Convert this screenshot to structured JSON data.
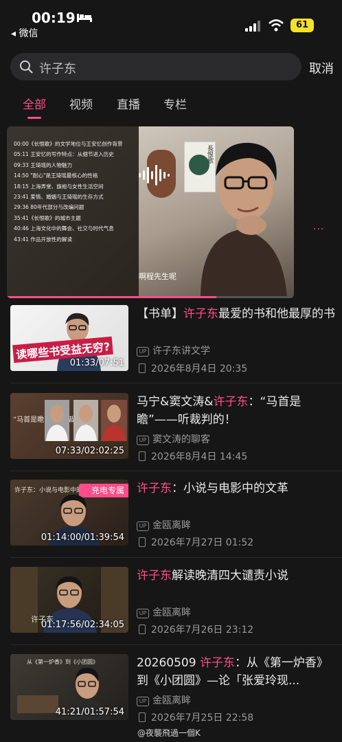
{
  "status_bar": {
    "time": "00:19",
    "back_app": "◂ 微信",
    "battery": "61"
  },
  "search": {
    "query": "许子东",
    "cancel": "取消"
  },
  "tabs": [
    {
      "label": "全部",
      "active": true
    },
    {
      "label": "视频",
      "active": false
    },
    {
      "label": "直播",
      "active": false
    },
    {
      "label": "专栏",
      "active": false
    }
  ],
  "player": {
    "chapters": [
      "00:00《长恨歌》的文学地位与王安忆创作背景",
      "05:11 王安忆的写作特点：从细节进入历史",
      "09:33 王琦瑶的人物魅力",
      "14:50 \"耐心\"是王琦瑶最核心的性格",
      "18:15 上海弄堂、旗袍与女性生活空间",
      "23:41 爱情、婚姻与王琦瑶的生存方式",
      "29:36 80年代部分与改编问题",
      "35:41《长恨歌》的城市主题",
      "40:46 上海文化中的舞会、社交与时代气息",
      "43:41 作品开放性的解读"
    ],
    "book_title": "長恨歌",
    "caption": "啊程先生呢",
    "progress": 0.73,
    "more": "···"
  },
  "results": [
    {
      "title_pre": "【书单】",
      "title_hl": "许子东",
      "title_post": "最爱的书和他最厚的书",
      "thumb_text": "读哪些书受益无穷?",
      "duration": "01:33/07:51",
      "uploader": "许子东讲文学",
      "date": "2026年8月4日 20:35"
    },
    {
      "title_pre": "马宁&窦文涛&",
      "title_hl": "许子东",
      "title_post": "：“马首是瞻”——听裁判的！",
      "thumb_text": "“马首是瞻”——听裁判的",
      "duration": "07:33/02:02:25",
      "uploader": "窦文涛的聊客",
      "date": "2026年8月4日 14:45"
    },
    {
      "title_pre": "",
      "title_hl": "许子东",
      "title_post": "：小说与电影中的文革",
      "thumb_text": "许子东：小说与电影中的文",
      "badge": "充电专属",
      "duration": "01:14:00/01:39:54",
      "uploader": "金瓯离眸",
      "date": "2026年7月27日 01:52"
    },
    {
      "title_pre": "",
      "title_hl": "许子东",
      "title_post": "解读晚清四大谴责小说",
      "thumb_text": "许子东",
      "duration": "01:17:56/02:34:05",
      "uploader": "金瓯离眸",
      "date": "2026年7月26日 23:12"
    },
    {
      "title_pre": "20260509 ",
      "title_hl": "许子东",
      "title_post": "：从《第一炉香》到《小团圆》—论「张爱玲现...",
      "thumb_text": "从《第一炉香》到《小团圆》",
      "duration": "41:21/01:57:54",
      "uploader": "金瓯离眸",
      "date": "2026年7月25日 22:58"
    }
  ],
  "watermark": "@夜襲飛過一個K",
  "colors": {
    "accent": "#ff4d8a",
    "background": "#161616"
  },
  "icons": [
    "sleep-bed-icon",
    "signal-icon",
    "wifi-icon",
    "search-icon",
    "sound-wave-icon",
    "uploader-up-icon",
    "phone-icon"
  ]
}
